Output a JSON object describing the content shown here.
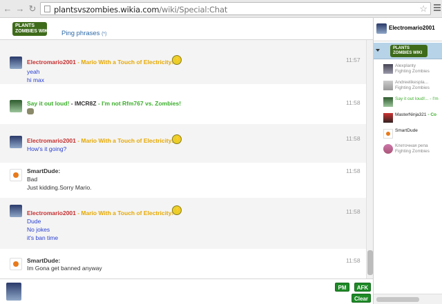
{
  "browser": {
    "url_host": "plantsvszombies.wikia.com",
    "url_path": "/wiki/Special:Chat"
  },
  "header": {
    "logo_line1": "PLANTS",
    "logo_line2": "ZOMBIES WIKI",
    "ping_label": "Ping phrases",
    "ping_count": "(*)"
  },
  "messages": [
    {
      "user": "Electromario2001",
      "status": " - Mario With a Touch of Electricity!",
      "time": "11:57",
      "lines": [
        "yeah",
        "hi max"
      ],
      "alt": true,
      "user_color": "#c62f2f",
      "status_color": "#e6a800",
      "text_color": "#2a3fd1"
    },
    {
      "user": "Say it out loud!",
      "sep": " - ",
      "user2": "IMCR8Z",
      "status": " - I'm not Rfm767 vs. Zombies!",
      "time": "11:58",
      "lines": [],
      "alt": false,
      "user_color": "#3aae2a",
      "status_color": "#3aae2a",
      "text_color": "#2a3fd1"
    },
    {
      "user": "Electromario2001",
      "status": " - Mario With a Touch of Electricity!",
      "time": "11:58",
      "lines": [
        "How's it going?"
      ],
      "alt": true,
      "user_color": "#c62f2f",
      "status_color": "#e6a800",
      "text_color": "#2a3fd1"
    },
    {
      "user": "SmartDude:",
      "status": "",
      "time": "11:58",
      "lines": [
        "Bad",
        "Just kidding.Sorry Mario."
      ],
      "alt": false,
      "user_color": "#333333",
      "status_color": "#333333",
      "text_color": "#333333"
    },
    {
      "user": "Electromario2001",
      "status": " - Mario With a Touch of Electricity!",
      "time": "11:58",
      "lines": [
        "Dude",
        "No jokes",
        "it's ban time"
      ],
      "alt": true,
      "user_color": "#c62f2f",
      "status_color": "#e6a800",
      "text_color": "#2a3fd1"
    },
    {
      "user": "SmartDude:",
      "status": "",
      "time": "11:58",
      "lines": [
        "Im Gona get banned anyway"
      ],
      "alt": false,
      "user_color": "#333333",
      "status_color": "#333333",
      "text_color": "#333333"
    }
  ],
  "input": {
    "pm_label": "PM",
    "afk_label": "AFK",
    "clear_label": "Clear"
  },
  "rail": {
    "me_name": "Electromario2001",
    "room_logo_line1": "PLANTS",
    "room_logo_line2": "ZOMBIES WIKI",
    "users": [
      {
        "name": "Alexplanty",
        "status": "Fighting Zombies",
        "name_color": "#888888",
        "status_color": "#888888"
      },
      {
        "name": "Andreelikespla...",
        "status": "Fighting Zombies",
        "name_color": "#888888",
        "status_color": "#888888"
      },
      {
        "name": "Say it out loud!...",
        "status": "- I'm",
        "name_color": "#3aae2a",
        "status_color": "#3aae2a"
      },
      {
        "name": "MasterNinja321",
        "status": "- Co",
        "name_color": "#222222",
        "status_color": "#3aae2a"
      },
      {
        "name": "SmartDude",
        "status": "",
        "name_color": "#222222",
        "status_color": "#888888"
      },
      {
        "name": "Клеточная репа",
        "status": "Fighting Zombies",
        "name_color": "#888888",
        "status_color": "#888888"
      }
    ]
  },
  "colors": {
    "accent_green": "#1e8a27",
    "link_blue": "#2a68a8",
    "room_highlight": "#b7d3e8"
  },
  "icons": [
    "back-arrow-icon",
    "forward-arrow-icon",
    "reload-icon",
    "page-icon",
    "bookmark-star-icon",
    "menu-icon",
    "electricity-badge-icon"
  ]
}
